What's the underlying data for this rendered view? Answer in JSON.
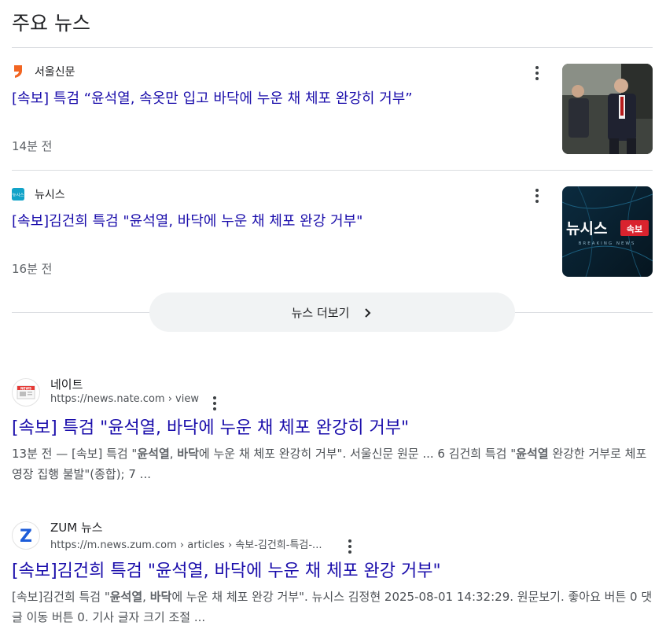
{
  "top_news": {
    "title": "주요 뉴스",
    "cards": [
      {
        "source": "서울신문",
        "title": "[속보] 특검 “윤석열, 속옷만 입고 바닥에 누운 채 체포 완강히 거부”",
        "time": "14분 전"
      },
      {
        "source": "뉴시스",
        "title": "[속보]김건희 특검 \"윤석열, 바닥에 누운 채 체포 완강 거부\"",
        "time": "16분 전",
        "thumb_brand": "뉴시스",
        "thumb_badge": "속보",
        "thumb_sub": "BREAKING NEWS",
        "logo_text": "뉴시스"
      }
    ],
    "more_label": "뉴스 더보기"
  },
  "results": [
    {
      "site": "네이트",
      "url": "https://news.nate.com › view",
      "favicon_text": "NEWS",
      "title": "[속보] 특검 \"윤석열, 바닥에 누운 채 체포 완강히 거부\"",
      "snippet": {
        "p1": "13분 전 — [속보] 특검 \"",
        "b1": "윤석열",
        "p2": ", ",
        "b2": "바닥",
        "p3": "에 누운 채 체포 완강히 거부\". 서울신문 원문 ... 6 김건희 특검 \"",
        "b3": "윤석열",
        "p4": " 완강한 거부로 체포영장 집행 불발\"(종합); 7 ..."
      }
    },
    {
      "site": "ZUM 뉴스",
      "url": "https://m.news.zum.com › articles › 속보-김건희-특검-...",
      "favicon_text": "Z",
      "title": "[속보]김건희 특검 \"윤석열, 바닥에 누운 채 체포 완강 거부\"",
      "snippet": {
        "p1": "[속보]김건희 특검 \"",
        "b1": "윤석열",
        "p2": ", ",
        "b2": "바닥",
        "p3": "에 누운 채 체포 완강 거부\". 뉴시스 김정현 2025-08-01 14:32:29. 원문보기. 좋아요 버튼 0 댓글 이동 버튼 0. 기사 글자 크기 조절 ..."
      }
    }
  ],
  "colors": {
    "link": "#1a0dab",
    "seoul_logo": "#f26522",
    "newsis_logo": "#12a3c8",
    "zum_blue": "#1c5cd9",
    "badge_red": "#d9232e"
  },
  "icons": [
    "seoul-logo-icon",
    "newsis-logo-icon",
    "kebab-menu-icon",
    "chevron-right-icon",
    "nate-favicon-icon",
    "zum-favicon-icon"
  ]
}
